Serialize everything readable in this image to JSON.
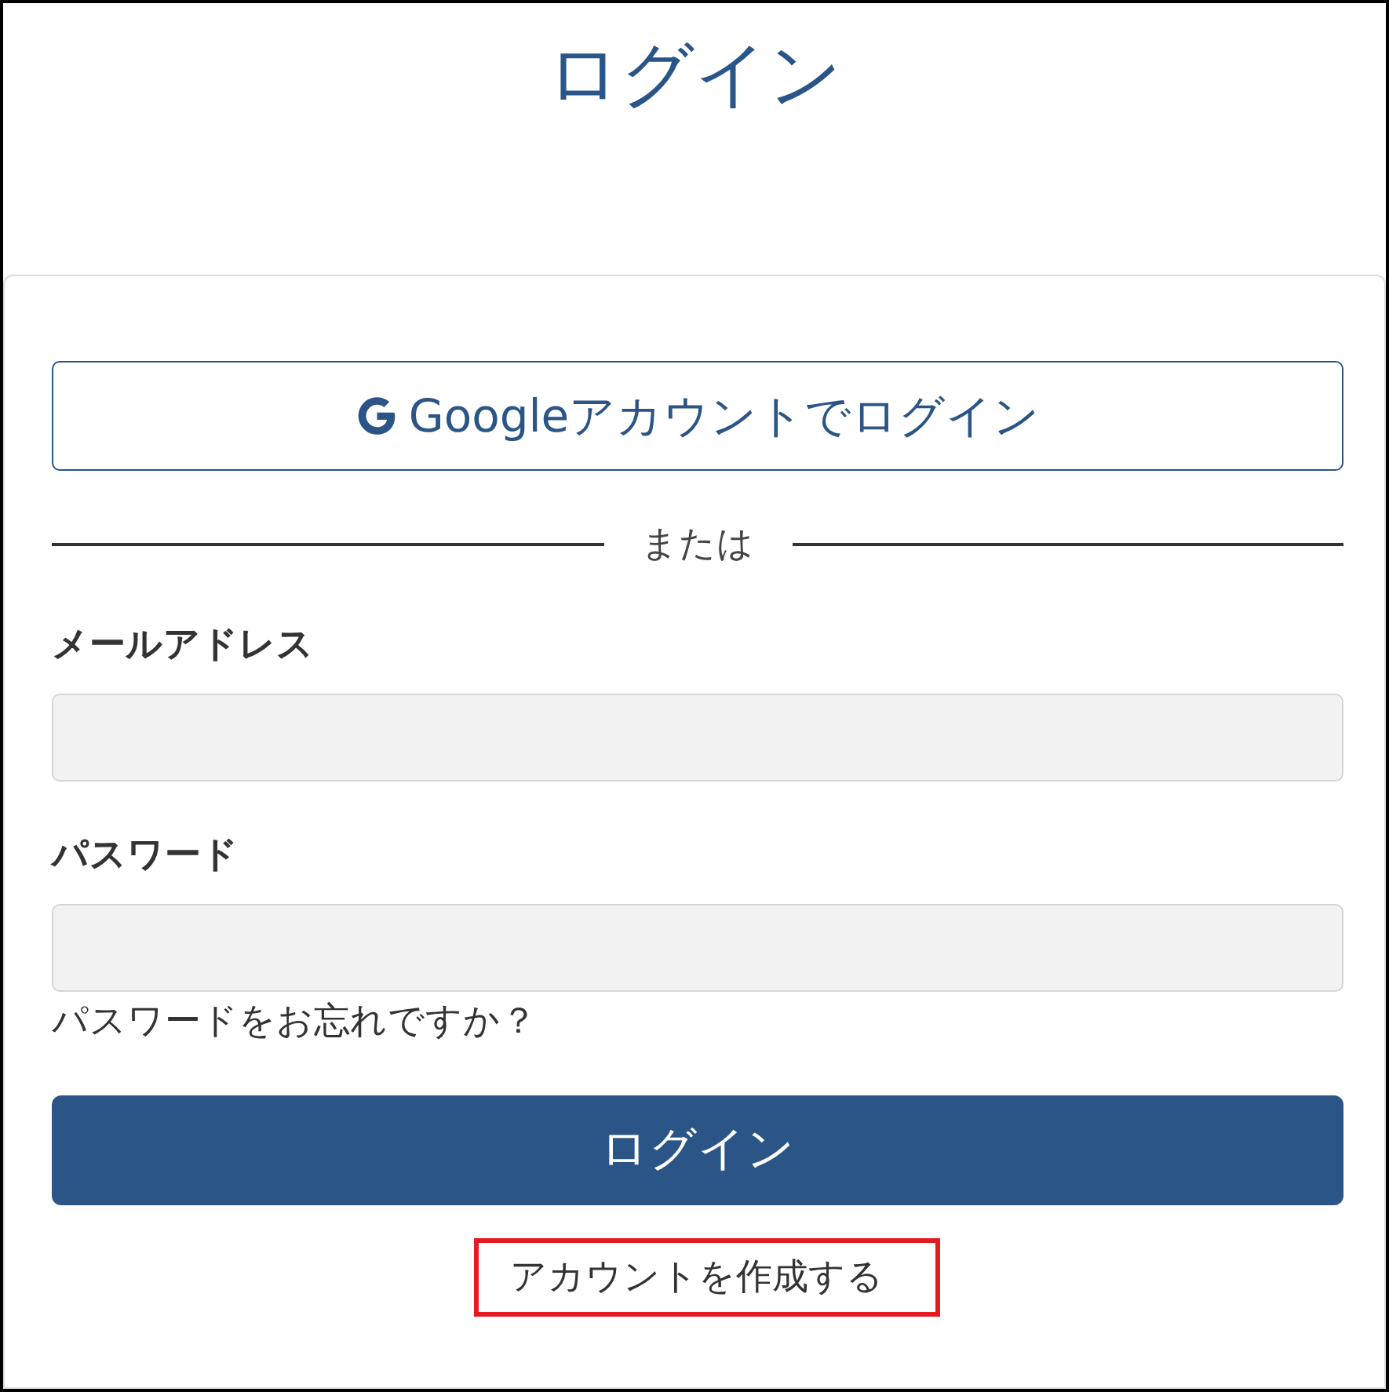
{
  "page": {
    "title": "ログイン"
  },
  "google_button": {
    "label": "Googleアカウントでログイン"
  },
  "divider": {
    "label": "または"
  },
  "fields": [
    {
      "label": "メールアドレス"
    },
    {
      "label": "パスワード"
    }
  ],
  "forgot_password_link": "パスワードをお忘れですか？",
  "login_button": "ログイン",
  "create_account_link": {
    "label": "アカウントを作成する",
    "highlighted": true
  }
}
